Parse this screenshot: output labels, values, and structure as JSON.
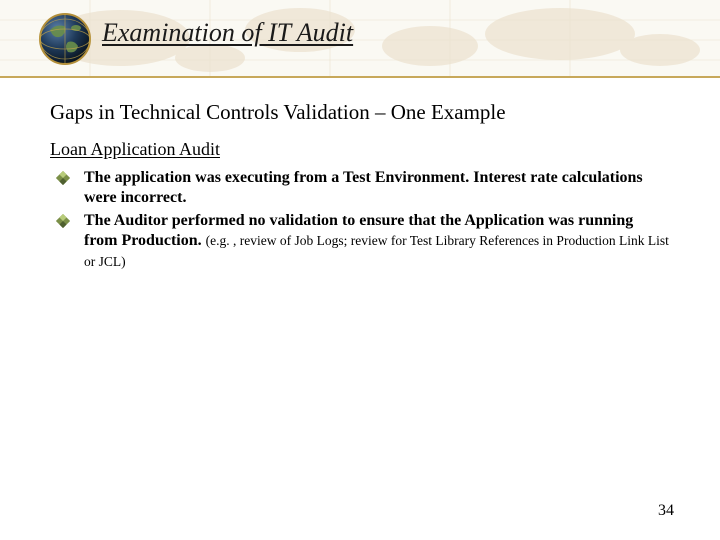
{
  "header": {
    "title": "Examination of IT Audit"
  },
  "subtitle": "Gaps in Technical Controls Validation – One Example",
  "section_heading": "Loan Application Audit",
  "bullets": [
    {
      "text": "The application was executing from a Test Environment.  Interest rate calculations were incorrect.",
      "note": ""
    },
    {
      "text": "The Auditor performed no validation to ensure that the Application was running from Production.  ",
      "note": "(e.g. , review of Job Logs; review for Test Library References in Production Link List or JCL)"
    }
  ],
  "page_number": "34"
}
